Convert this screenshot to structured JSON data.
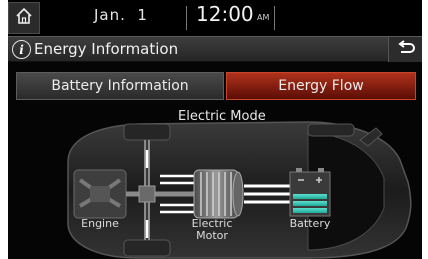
{
  "status": {
    "date": "Jan.  1",
    "time": "12:00",
    "ampm": "AM"
  },
  "header": {
    "title": "Energy Information"
  },
  "tabs": [
    {
      "label": "Battery Information",
      "active": false
    },
    {
      "label": "Energy Flow",
      "active": true
    }
  ],
  "flow": {
    "mode": "Electric Mode",
    "components": {
      "engine": "Engine",
      "motor_line1": "Electric",
      "motor_line2": "Motor",
      "battery": "Battery"
    }
  },
  "icons": {
    "home": "home-icon",
    "info": "info-icon",
    "back": "back-arrow-icon"
  },
  "colors": {
    "active_tab": "#b0321c",
    "battery_charge": "#34c4b4",
    "flow_line": "#ffffff"
  }
}
